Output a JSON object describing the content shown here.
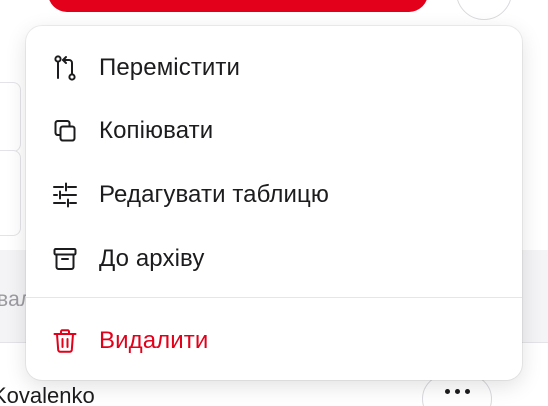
{
  "background": {
    "table_header_partial": "вал",
    "row_name_partial": "Kovalenko",
    "more_icon": "more-horizontal-icon"
  },
  "context_menu": {
    "items": [
      {
        "label": "Перемістити",
        "icon": "move-icon"
      },
      {
        "label": "Копіювати",
        "icon": "copy-icon"
      },
      {
        "label": "Редагувати таблицю",
        "icon": "sliders-icon"
      },
      {
        "label": "До архіву",
        "icon": "archive-icon"
      }
    ],
    "danger_item": {
      "label": "Видалити",
      "icon": "trash-icon"
    }
  },
  "colors": {
    "danger": "#e3001b",
    "text": "#1c1c1e",
    "primary_button": "#e3001b"
  }
}
